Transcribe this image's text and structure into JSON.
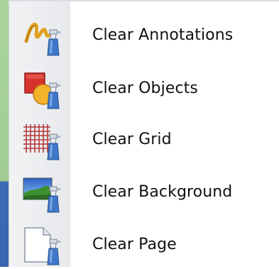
{
  "menu": {
    "items": [
      {
        "label": "Clear Annotations",
        "icon": "clear-annotations-icon"
      },
      {
        "label": "Clear Objects",
        "icon": "clear-objects-icon"
      },
      {
        "label": "Clear Grid",
        "icon": "clear-grid-icon"
      },
      {
        "label": "Clear Background",
        "icon": "clear-background-icon"
      },
      {
        "label": "Clear Page",
        "icon": "clear-page-icon"
      }
    ]
  },
  "colors": {
    "gutter": "#eceef0",
    "text": "#111111",
    "spray_bottle": "#3f77c9",
    "annotation_stroke": "#e0a21e",
    "object_square": "#d8322a",
    "object_circle": "#f2b22a",
    "grid_lines": "#b33b3b"
  }
}
